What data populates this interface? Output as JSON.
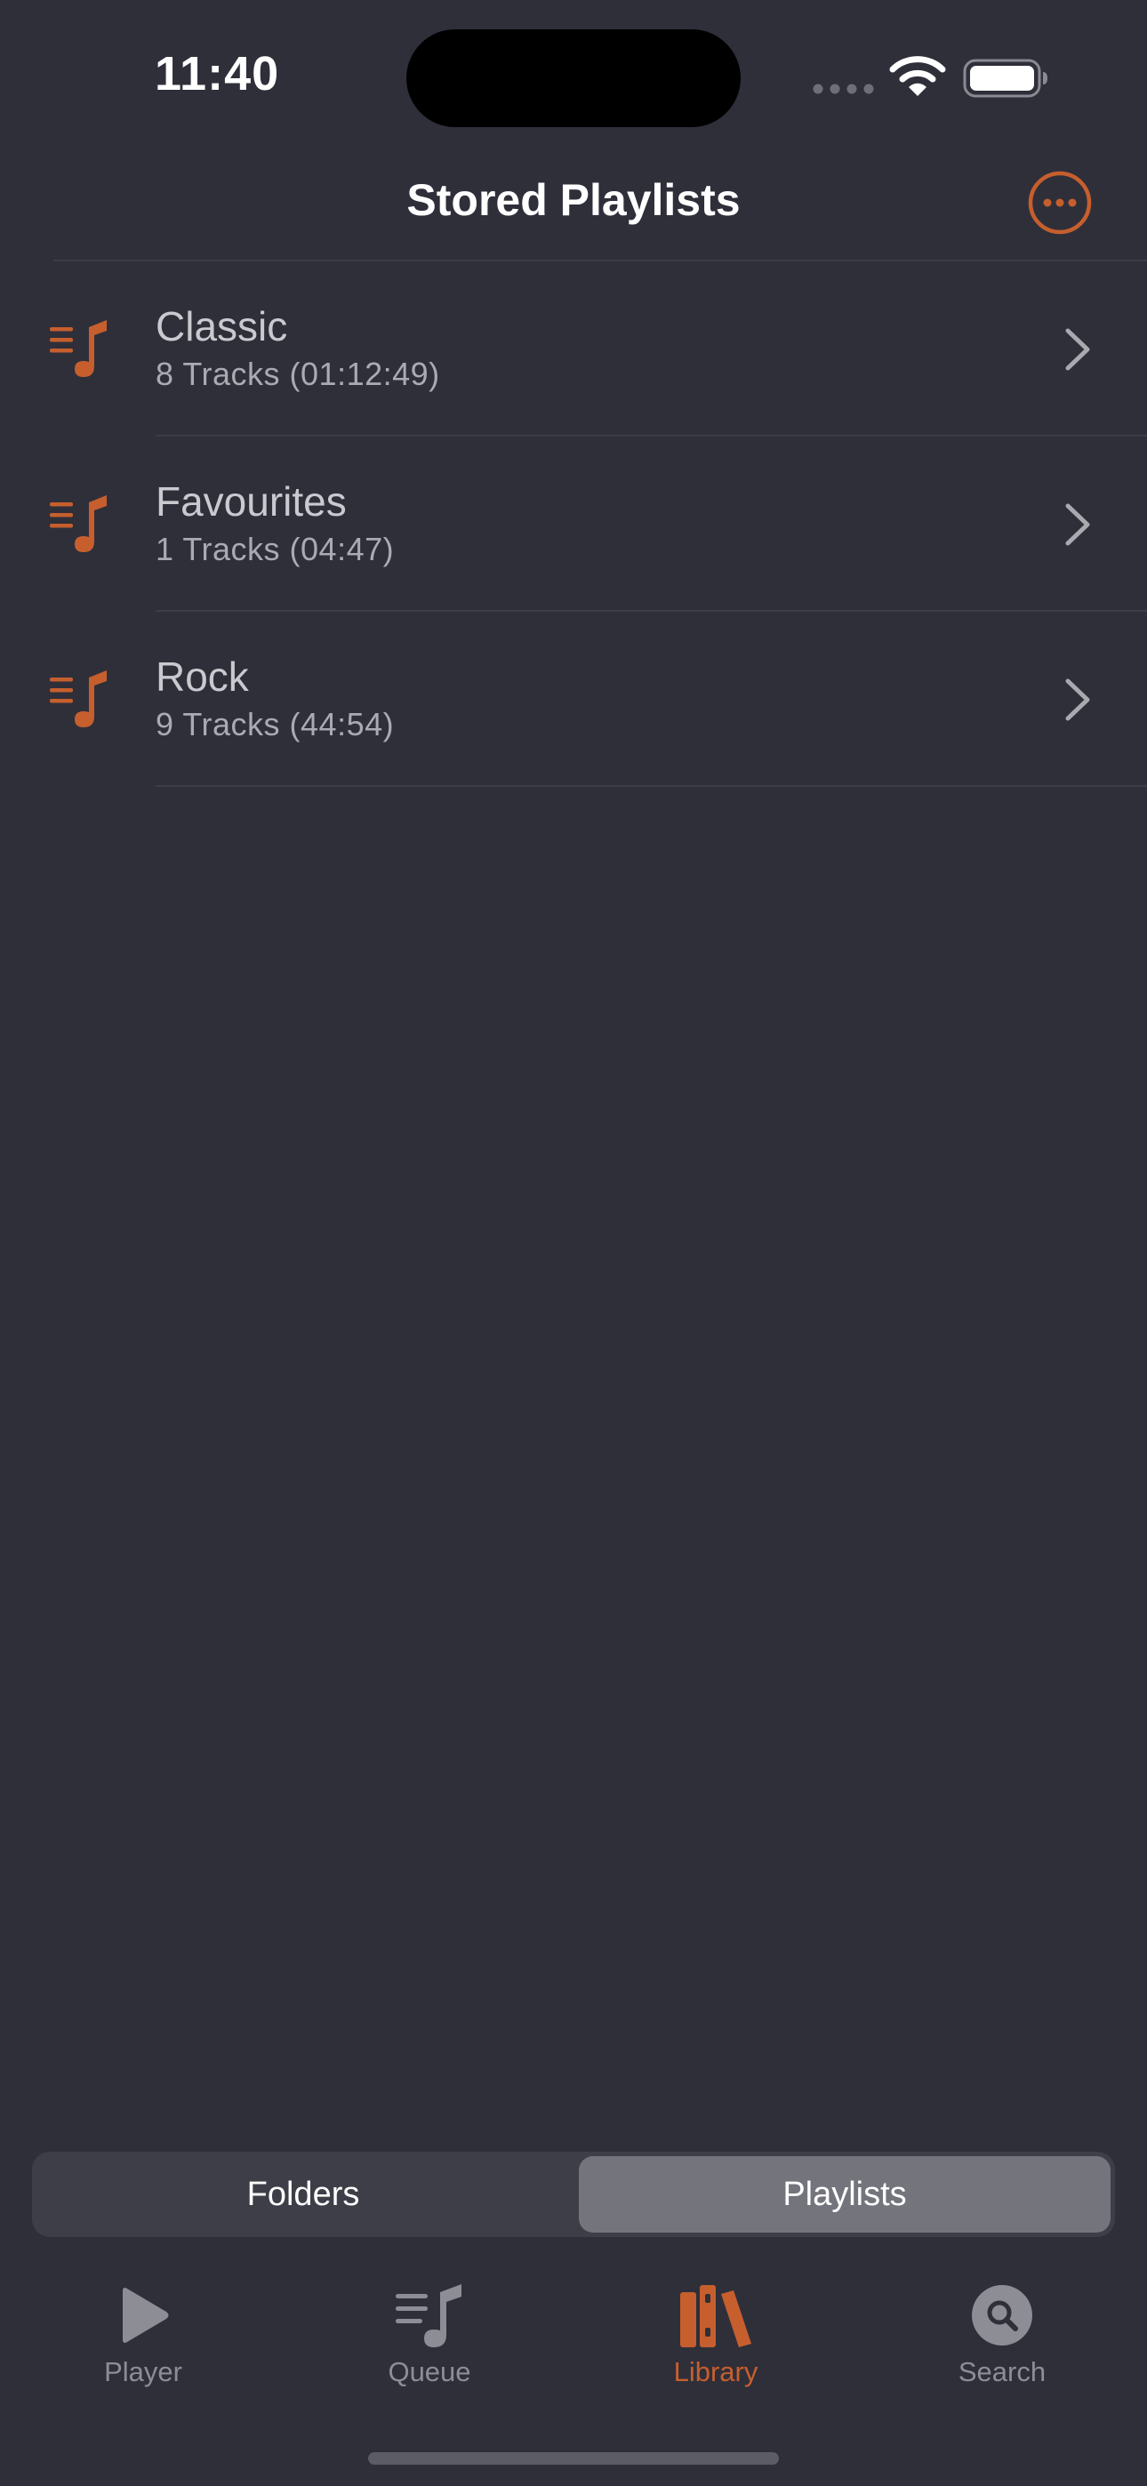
{
  "status_bar": {
    "time": "11:40",
    "icons": [
      "cellular-dots-icon",
      "wifi-icon",
      "battery-icon"
    ]
  },
  "nav": {
    "title": "Stored Playlists",
    "more_icon": "ellipsis-circle-icon"
  },
  "playlists": [
    {
      "name": "Classic",
      "detail": "8 Tracks (01:12:49)",
      "icon": "playlist-note-icon"
    },
    {
      "name": "Favourites",
      "detail": "1 Tracks (04:47)",
      "icon": "playlist-note-icon"
    },
    {
      "name": "Rock",
      "detail": "9 Tracks (44:54)",
      "icon": "playlist-note-icon"
    }
  ],
  "segmented": {
    "options": [
      "Folders",
      "Playlists"
    ],
    "selected": "Playlists"
  },
  "tabs": [
    {
      "label": "Player",
      "icon": "play-icon",
      "active": false
    },
    {
      "label": "Queue",
      "icon": "queue-icon",
      "active": false
    },
    {
      "label": "Library",
      "icon": "library-icon",
      "active": true
    },
    {
      "label": "Search",
      "icon": "search-icon",
      "active": false
    }
  ],
  "colors": {
    "background": "#2f2f3a",
    "accent": "#c65f2d",
    "inactive_tab": "#8d8d96",
    "row_title": "#c9c9cf",
    "row_detail": "#aaaab2",
    "segment_selected": "#74747d",
    "segment_track": "#3e3e49"
  }
}
